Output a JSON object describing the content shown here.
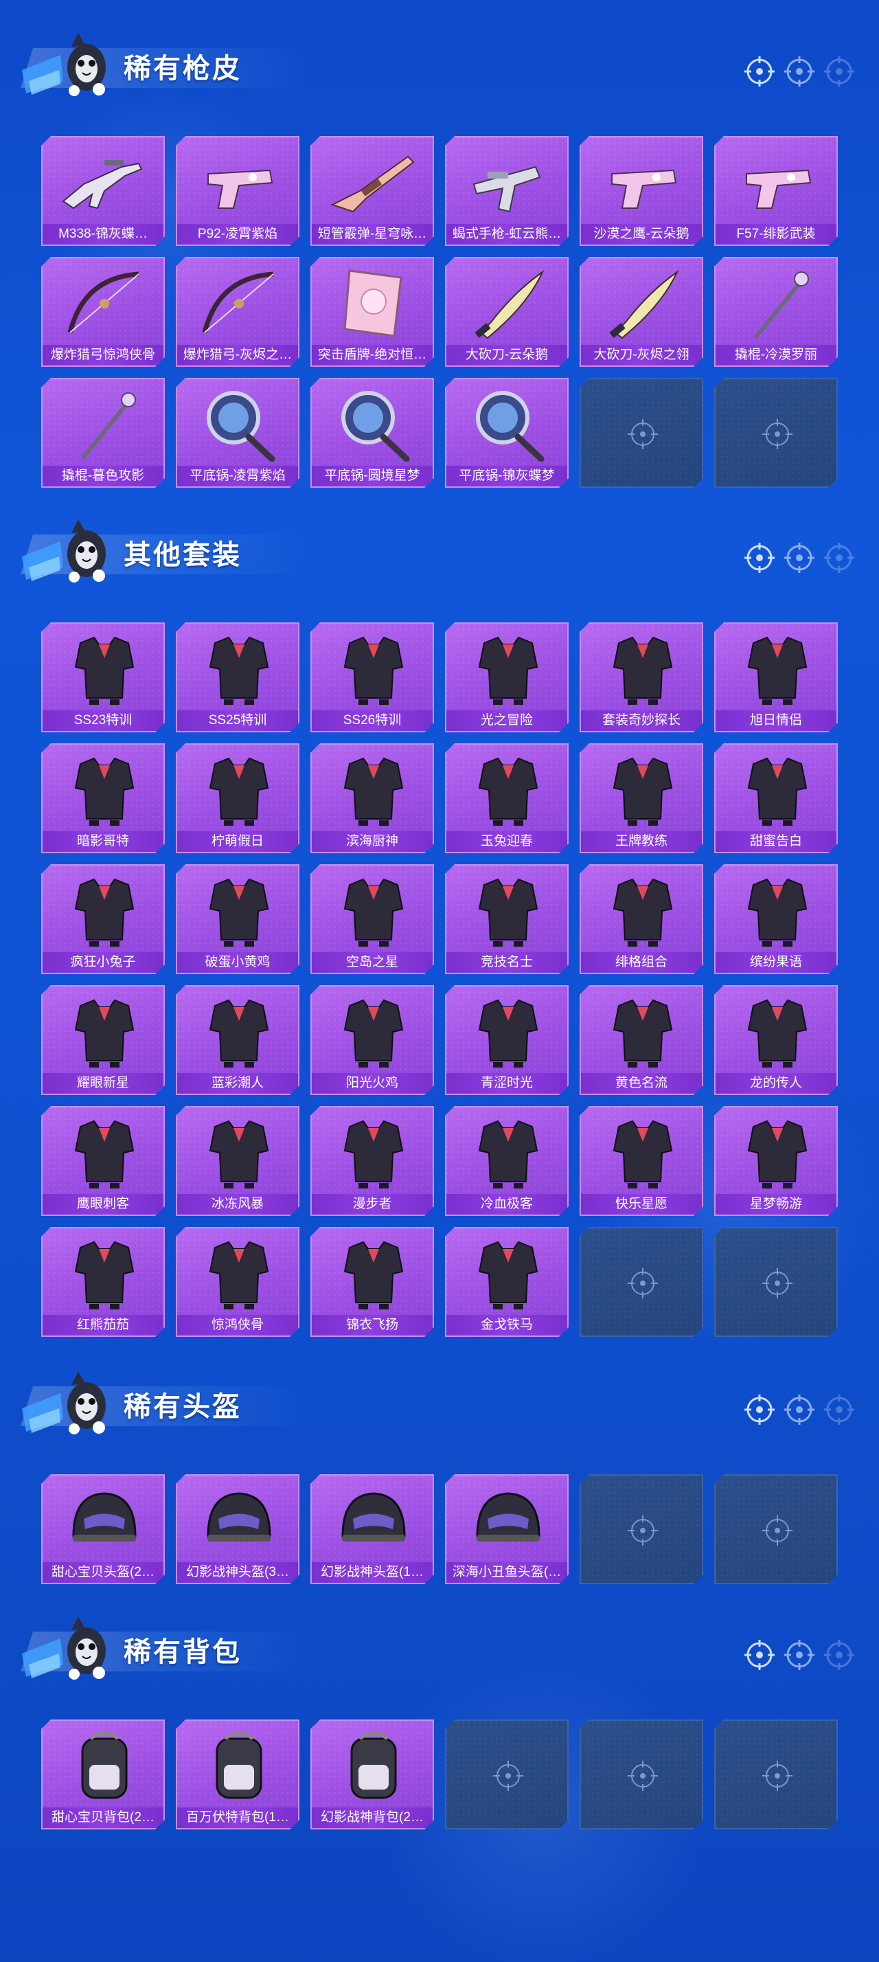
{
  "colors": {
    "background": "#0f52d4",
    "tile_filled": "#9c4fe3",
    "tile_border": "#c98cff",
    "label_bar": "#8d3fe0",
    "tile_empty": "#24457d"
  },
  "sections": [
    {
      "title": "稀有枪皮",
      "items": [
        {
          "label": "M338-锦灰蝶…",
          "icon": "rifle-icon"
        },
        {
          "label": "P92-凌霄紫焰",
          "icon": "pistol-icon"
        },
        {
          "label": "短管霰弹-星穹咏…",
          "icon": "shotgun-icon"
        },
        {
          "label": "蝎式手枪-虹云熊…",
          "icon": "smg-icon"
        },
        {
          "label": "沙漠之鹰-云朵鹅",
          "icon": "pistol-icon"
        },
        {
          "label": "F57-绯影武装",
          "icon": "pistol-icon"
        },
        {
          "label": "爆炸猎弓惊鸿侠骨",
          "icon": "bow-icon"
        },
        {
          "label": "爆炸猎弓-灰烬之…",
          "icon": "bow-icon"
        },
        {
          "label": "突击盾牌-绝对恒…",
          "icon": "shield-icon"
        },
        {
          "label": "大砍刀-云朵鹅",
          "icon": "machete-icon"
        },
        {
          "label": "大砍刀-灰烬之翎",
          "icon": "machete-icon"
        },
        {
          "label": "撬棍-冷漠罗丽",
          "icon": "crowbar-icon"
        },
        {
          "label": "撬棍-暮色攻影",
          "icon": "crowbar-icon"
        },
        {
          "label": "平底锅-凌霄紫焰",
          "icon": "pan-icon"
        },
        {
          "label": "平底锅-圆境星梦",
          "icon": "pan-icon"
        },
        {
          "label": "平底锅-锦灰蝶梦",
          "icon": "pan-icon"
        }
      ],
      "slots": 18
    },
    {
      "title": "其他套装",
      "items": [
        {
          "label": "SS23特训",
          "icon": "outfit-icon"
        },
        {
          "label": "SS25特训",
          "icon": "outfit-icon"
        },
        {
          "label": "SS26特训",
          "icon": "outfit-icon"
        },
        {
          "label": "光之冒险",
          "icon": "outfit-icon"
        },
        {
          "label": "套装奇妙探长",
          "icon": "outfit-icon"
        },
        {
          "label": "旭日情侣",
          "icon": "outfit-icon"
        },
        {
          "label": "暗影哥特",
          "icon": "outfit-icon"
        },
        {
          "label": "柠萌假日",
          "icon": "outfit-icon"
        },
        {
          "label": "滨海厨神",
          "icon": "outfit-icon"
        },
        {
          "label": "玉兔迎春",
          "icon": "outfit-icon"
        },
        {
          "label": "王牌教练",
          "icon": "outfit-icon"
        },
        {
          "label": "甜蜜告白",
          "icon": "outfit-icon"
        },
        {
          "label": "疯狂小兔子",
          "icon": "outfit-icon"
        },
        {
          "label": "破蛋小黄鸡",
          "icon": "outfit-icon"
        },
        {
          "label": "空岛之星",
          "icon": "outfit-icon"
        },
        {
          "label": "竞技名士",
          "icon": "outfit-icon"
        },
        {
          "label": "绯格组合",
          "icon": "outfit-icon"
        },
        {
          "label": "缤纷果语",
          "icon": "outfit-icon"
        },
        {
          "label": "耀眼新星",
          "icon": "outfit-icon"
        },
        {
          "label": "蓝彩潮人",
          "icon": "outfit-icon"
        },
        {
          "label": "阳光火鸡",
          "icon": "outfit-icon"
        },
        {
          "label": "青涩时光",
          "icon": "outfit-icon"
        },
        {
          "label": "黄色名流",
          "icon": "outfit-icon"
        },
        {
          "label": "龙的传人",
          "icon": "outfit-icon"
        },
        {
          "label": "鹰眼刺客",
          "icon": "outfit-icon"
        },
        {
          "label": "冰冻风暴",
          "icon": "outfit-icon"
        },
        {
          "label": "漫步者",
          "icon": "outfit-icon"
        },
        {
          "label": "冷血极客",
          "icon": "outfit-icon"
        },
        {
          "label": "快乐星愿",
          "icon": "outfit-icon"
        },
        {
          "label": "星梦畅游",
          "icon": "outfit-icon"
        },
        {
          "label": "红熊茄茄",
          "icon": "outfit-icon"
        },
        {
          "label": "惊鸿侠骨",
          "icon": "outfit-icon"
        },
        {
          "label": "锦衣飞扬",
          "icon": "outfit-icon"
        },
        {
          "label": "金戈铁马",
          "icon": "outfit-icon"
        }
      ],
      "slots": 36
    },
    {
      "title": "稀有头盔",
      "items": [
        {
          "label": "甜心宝贝头盔(2…",
          "icon": "helmet-icon"
        },
        {
          "label": "幻影战神头盔(3…",
          "icon": "helmet-icon"
        },
        {
          "label": "幻影战神头盔(1…",
          "icon": "helmet-icon"
        },
        {
          "label": "深海小丑鱼头盔(…",
          "icon": "helmet-icon"
        }
      ],
      "slots": 6
    },
    {
      "title": "稀有背包",
      "items": [
        {
          "label": "甜心宝贝背包(2…",
          "icon": "backpack-icon"
        },
        {
          "label": "百万伏特背包(1…",
          "icon": "backpack-icon"
        },
        {
          "label": "幻影战神背包(2…",
          "icon": "backpack-icon"
        }
      ],
      "slots": 6
    }
  ]
}
